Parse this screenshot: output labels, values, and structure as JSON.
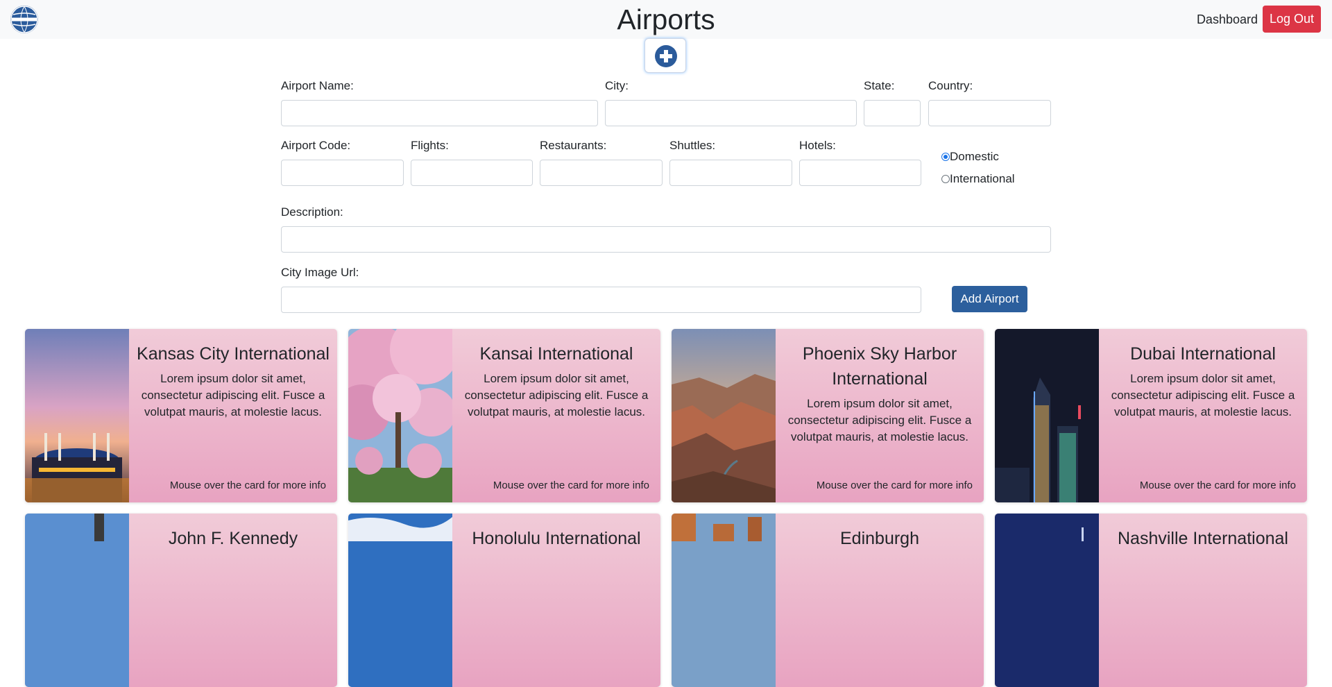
{
  "header": {
    "logo_icon": "pan-am-globe-icon",
    "title": "Airports",
    "dashboard_link": "Dashboard",
    "logout_label": "Log Out",
    "accent_color": "#dc3545"
  },
  "form": {
    "toggle_icon": "plus-circle-icon",
    "labels": {
      "airport_name": "Airport Name:",
      "city": "City:",
      "state": "State:",
      "country": "Country:",
      "airport_code": "Airport Code:",
      "flights": "Flights:",
      "restaurants": "Restaurants:",
      "shuttles": "Shuttles:",
      "hotels": "Hotels:",
      "description": "Description:",
      "city_image_url": "City Image Url:"
    },
    "values": {
      "airport_name": "",
      "city": "",
      "state": "",
      "country": "",
      "airport_code": "",
      "flights": "",
      "restaurants": "",
      "shuttles": "",
      "hotels": "",
      "description": "",
      "city_image_url": ""
    },
    "radio": {
      "domestic": "Domestic",
      "international": "International",
      "selected": "Domestic"
    },
    "submit_label": "Add Airport",
    "submit_color": "#2c5f9d"
  },
  "cards": [
    {
      "title": "Kansas City International",
      "text": "Lorem ipsum dolor sit amet, consectetur adipiscing elit. Fusce a volutpat mauris, at molestie lacus.",
      "footer": "Mouse over the card for more info"
    },
    {
      "title": "Kansai International",
      "text": "Lorem ipsum dolor sit amet, consectetur adipiscing elit. Fusce a volutpat mauris, at molestie lacus.",
      "footer": "Mouse over the card for more info"
    },
    {
      "title": "Phoenix Sky Harbor International",
      "text": "Lorem ipsum dolor sit amet, consectetur adipiscing elit. Fusce a volutpat mauris, at molestie lacus.",
      "footer": "Mouse over the card for more info"
    },
    {
      "title": "Dubai International",
      "text": "Lorem ipsum dolor sit amet, consectetur adipiscing elit. Fusce a volutpat mauris, at molestie lacus.",
      "footer": "Mouse over the card for more info"
    },
    {
      "title": "John F. Kennedy",
      "text": "",
      "footer": ""
    },
    {
      "title": "Honolulu International",
      "text": "",
      "footer": ""
    },
    {
      "title": "Edinburgh",
      "text": "",
      "footer": ""
    },
    {
      "title": "Nashville International",
      "text": "",
      "footer": ""
    }
  ]
}
